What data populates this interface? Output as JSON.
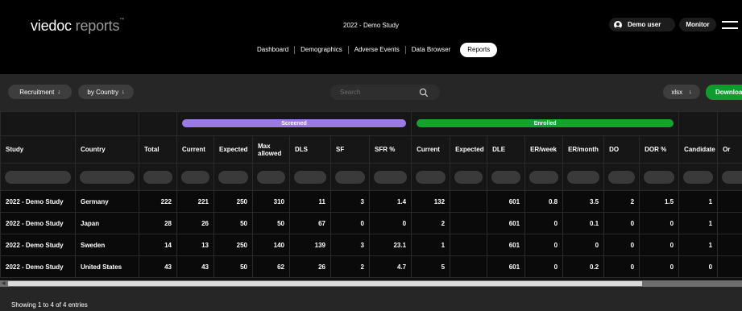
{
  "header": {
    "logo_primary": "viedoc",
    "logo_secondary": "reports",
    "logo_tm": "™",
    "study_title": "2022 - Demo Study",
    "user_label": "Demo user",
    "monitor_label": "Monitor"
  },
  "nav": {
    "tabs": [
      {
        "label": "Dashboard"
      },
      {
        "label": "Demographics"
      },
      {
        "label": "Adverse Events"
      },
      {
        "label": "Data Browser"
      },
      {
        "label": "Reports",
        "active": true
      }
    ]
  },
  "toolbar": {
    "recruitment_label": "Recruitment",
    "by_country_label": "by Country",
    "search_placeholder": "Search",
    "format_label": "xlsx",
    "download_label": "Download",
    "arrow_glyph": "↓"
  },
  "table": {
    "groups": {
      "screened": "Screened",
      "enrolled": "Enrolled"
    },
    "columns": [
      {
        "label": "Study"
      },
      {
        "label": "Country"
      },
      {
        "label": "Total"
      },
      {
        "label": "Current"
      },
      {
        "label": "Expected"
      },
      {
        "label": "Max allowed"
      },
      {
        "label": "DLS"
      },
      {
        "label": "SF"
      },
      {
        "label": "SFR %"
      },
      {
        "label": "Current"
      },
      {
        "label": "Expected"
      },
      {
        "label": "DLE"
      },
      {
        "label": "ER/week"
      },
      {
        "label": "ER/month"
      },
      {
        "label": "DO"
      },
      {
        "label": "DOR %"
      },
      {
        "label": "Candidate"
      },
      {
        "label": "Or"
      }
    ],
    "rows": [
      [
        "2022 - Demo Study",
        "Germany",
        "222",
        "221",
        "250",
        "310",
        "11",
        "3",
        "1.4",
        "132",
        "",
        "601",
        "0.8",
        "3.5",
        "2",
        "1.5",
        "1",
        ""
      ],
      [
        "2022 - Demo Study",
        "Japan",
        "28",
        "26",
        "50",
        "50",
        "67",
        "0",
        "0",
        "2",
        "",
        "601",
        "0",
        "0.1",
        "0",
        "0",
        "1",
        ""
      ],
      [
        "2022 - Demo Study",
        "Sweden",
        "14",
        "13",
        "250",
        "140",
        "139",
        "3",
        "23.1",
        "1",
        "",
        "601",
        "0",
        "0",
        "0",
        "0",
        "1",
        ""
      ],
      [
        "2022 - Demo Study",
        "United States",
        "43",
        "43",
        "50",
        "62",
        "26",
        "2",
        "4.7",
        "5",
        "",
        "601",
        "0",
        "0.2",
        "0",
        "0",
        "0",
        ""
      ]
    ]
  },
  "footer": {
    "info": "Showing 1 to 4 of 4 entries"
  },
  "colors": {
    "screened": "#9b7ae6",
    "enrolled": "#11a52f",
    "download": "#0f9b2e"
  }
}
